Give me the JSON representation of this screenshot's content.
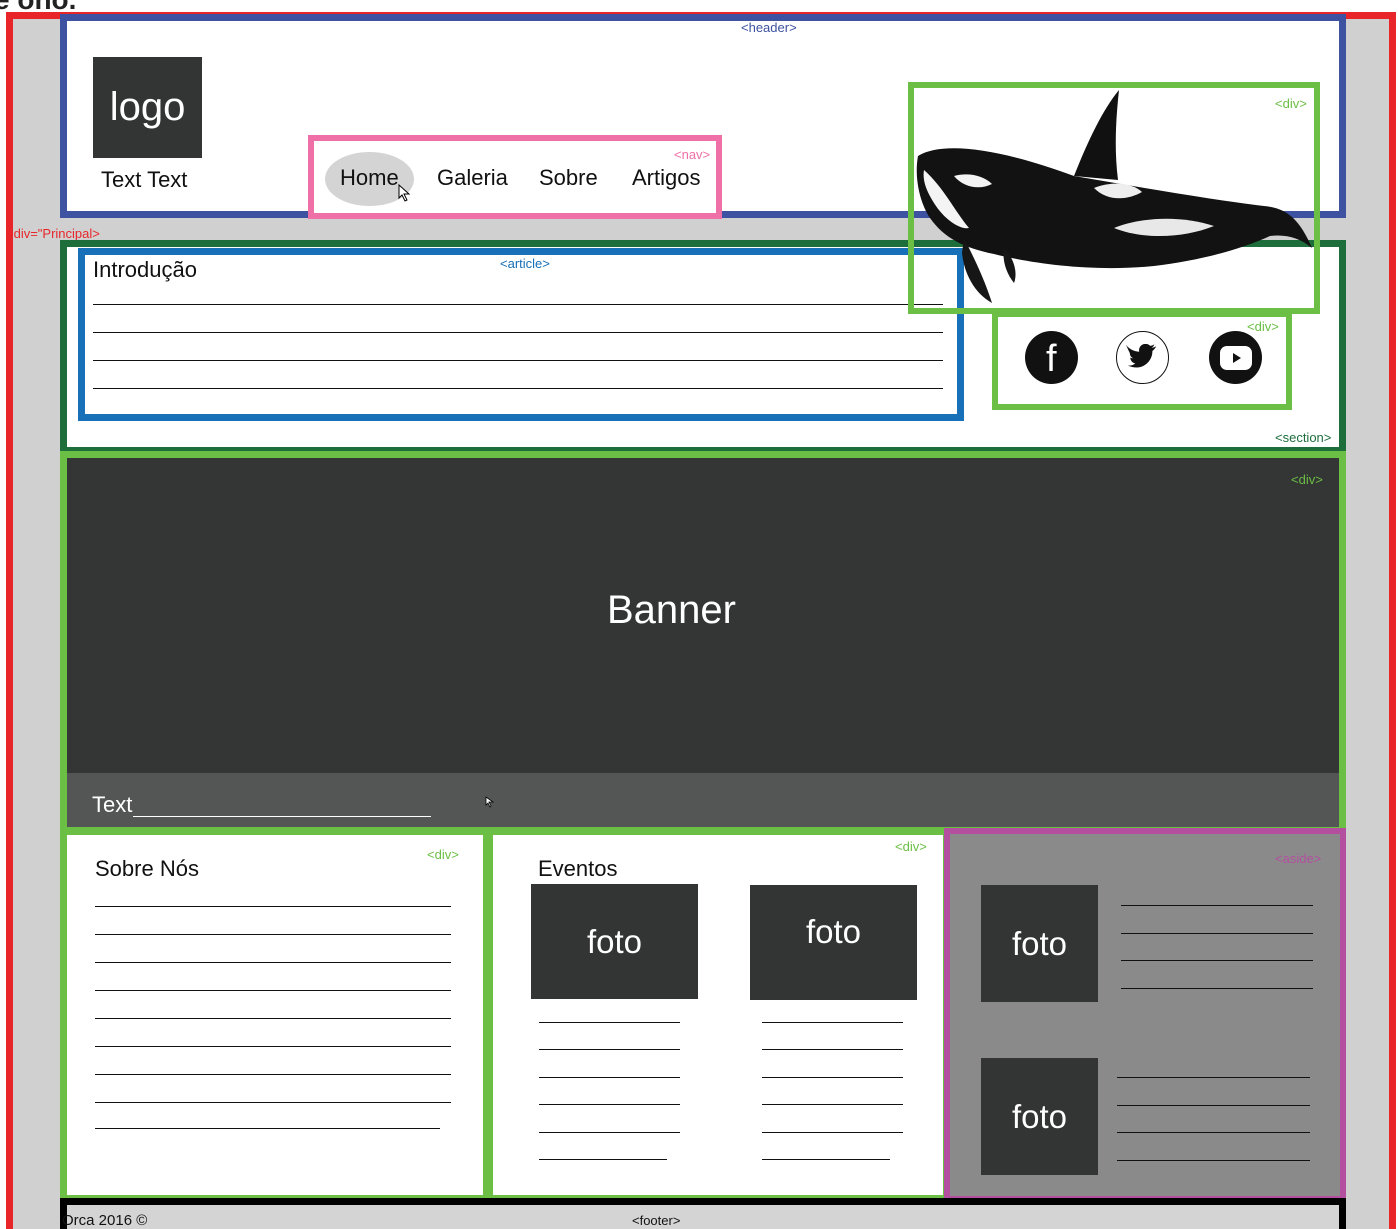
{
  "page": {
    "top_cut_text": "e ono.",
    "principal_label": "<div=\"Principal>"
  },
  "header": {
    "tag": "<header>",
    "logo": "logo",
    "logo_subtitle": "Text Text",
    "nav_tag": "<nav>",
    "nav_items": [
      "Home",
      "Galeria",
      "Sobre",
      "Artigos"
    ],
    "whale_tag": "<div>"
  },
  "section": {
    "tag": "<section>",
    "article_tag": "<article>",
    "article_title": "Introdução",
    "social_tag": "<div>",
    "social_icons": [
      "facebook-icon",
      "twitter-icon",
      "youtube-icon"
    ]
  },
  "banner": {
    "tag": "<div>",
    "title": "Banner",
    "caption": "Text"
  },
  "about": {
    "tag": "<div>",
    "title": "Sobre Nós"
  },
  "events": {
    "tag": "<div>",
    "title": "Eventos",
    "photo_label": "foto"
  },
  "aside": {
    "tag": "<aside>",
    "photo_label": "foto"
  },
  "footer": {
    "text": "Orca 2016 ©",
    "tag": "<footer>"
  },
  "colors": {
    "principal": "#e8262a",
    "header": "#3d52a0",
    "nav": "#ef6fa7",
    "div_green": "#6bbf45",
    "section": "#1e6e3c",
    "article": "#1770b8",
    "aside": "#b44fa0",
    "dark_block": "#333434"
  }
}
